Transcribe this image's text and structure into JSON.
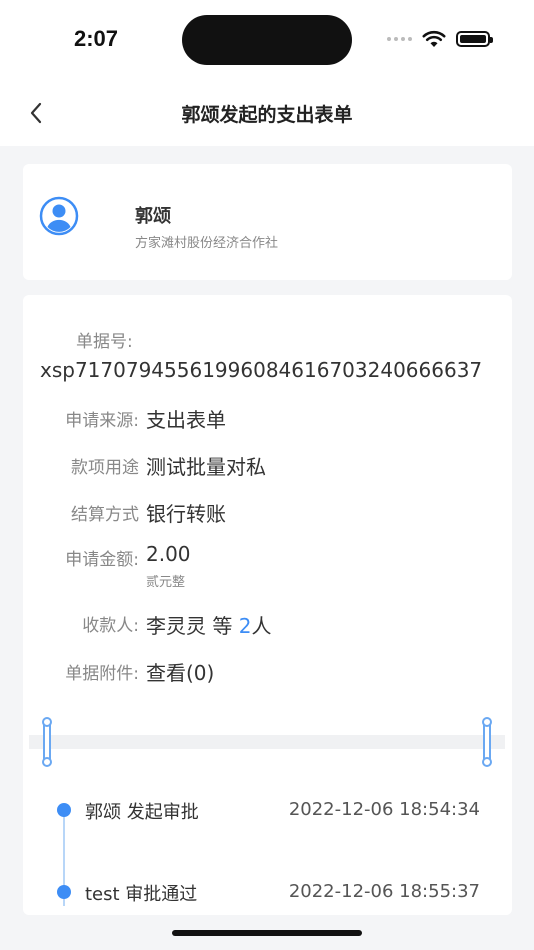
{
  "status": {
    "time": "2:07"
  },
  "nav": {
    "title": "郭颂发起的支出表单"
  },
  "user": {
    "name": "郭颂",
    "org": "方家滩村股份经济合作社"
  },
  "detail": {
    "doc_no_label": "单据号:",
    "doc_no_value": "xsp71707945561996084616703240666637",
    "source_label": "申请来源:",
    "source_value": "支出表单",
    "purpose_label": "款项用途",
    "purpose_value": "测试批量对私",
    "settle_label": "结算方式",
    "settle_value": "银行转账",
    "amount_label": "申请金额:",
    "amount_value": "2.00",
    "amount_words": "贰元整",
    "payee_label": "收款人:",
    "payee_name": "李灵灵 等 ",
    "payee_count": "2",
    "payee_suffix": "人",
    "attach_label": "单据附件:",
    "attach_value": "查看(0)"
  },
  "timeline": [
    {
      "text": "郭颂 发起审批",
      "time": "2022-12-06 18:54:34"
    },
    {
      "text": "test 审批通过",
      "time": "2022-12-06 18:55:37"
    }
  ],
  "colors": {
    "accent": "#3d8df5",
    "background": "#f4f5f7"
  },
  "icons": {
    "back": "chevron-left-icon",
    "avatar": "user-avatar-icon"
  }
}
